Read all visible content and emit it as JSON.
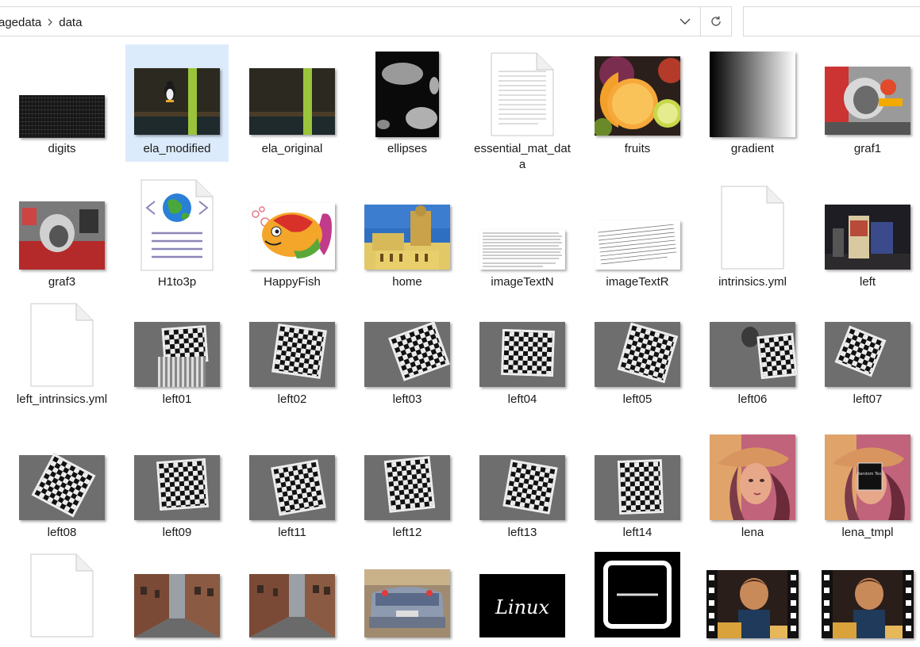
{
  "breadcrumb": {
    "parent": "agedata",
    "current": "data"
  },
  "files": [
    {
      "name": "digits"
    },
    {
      "name": "ela_modified"
    },
    {
      "name": "ela_original"
    },
    {
      "name": "ellipses"
    },
    {
      "name": "essential_mat_data"
    },
    {
      "name": "fruits"
    },
    {
      "name": "gradient"
    },
    {
      "name": "graf1"
    },
    {
      "name": "graf3"
    },
    {
      "name": "H1to3p"
    },
    {
      "name": "HappyFish"
    },
    {
      "name": "home"
    },
    {
      "name": "imageTextN"
    },
    {
      "name": "imageTextR"
    },
    {
      "name": "intrinsics.yml"
    },
    {
      "name": "left"
    },
    {
      "name": "left_intrinsics.yml"
    },
    {
      "name": "left01"
    },
    {
      "name": "left02"
    },
    {
      "name": "left03"
    },
    {
      "name": "left04"
    },
    {
      "name": "left05"
    },
    {
      "name": "left06"
    },
    {
      "name": "left07"
    },
    {
      "name": "left08"
    },
    {
      "name": "left09"
    },
    {
      "name": "left11"
    },
    {
      "name": "left12"
    },
    {
      "name": "left13"
    },
    {
      "name": "left14"
    },
    {
      "name": "lena"
    },
    {
      "name": "lena_tmpl"
    }
  ],
  "embedded_text": {
    "linux_logo": "Linux",
    "random_text": "Random Text"
  },
  "selected_file": "ela_modified"
}
